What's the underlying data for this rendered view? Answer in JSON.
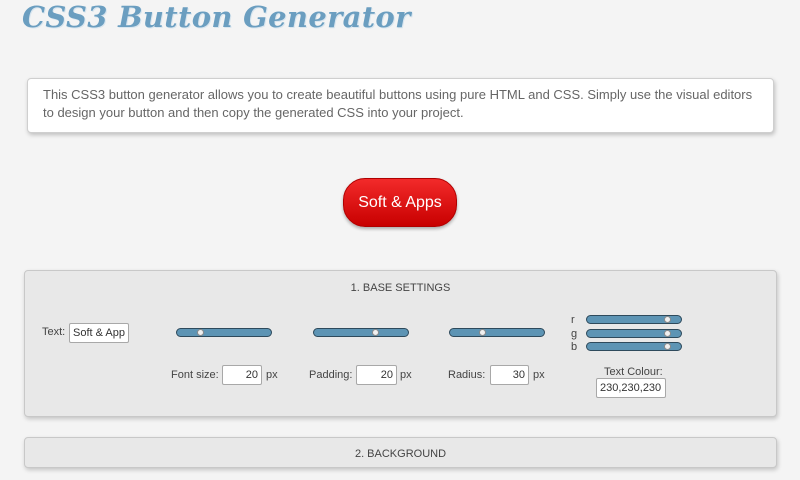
{
  "header": {
    "title": "CSS3 Button Generator"
  },
  "intro": {
    "text": "This CSS3 button generator allows you to create beautiful buttons using pure HTML and CSS. Simply use the visual editors to design your button and then copy the generated CSS into your project."
  },
  "preview": {
    "button_label": "Soft & Apps",
    "color": "#e01414"
  },
  "base_settings": {
    "title": "1. BASE SETTINGS",
    "text_label": "Text:",
    "text_value": "Soft & Apps",
    "font_size": {
      "label": "Font size:",
      "value": "20",
      "unit": "px",
      "slider_level": 0.25
    },
    "padding": {
      "label": "Padding:",
      "value": "20",
      "unit": "px",
      "slider_level": 0.65
    },
    "radius": {
      "label": "Radius:",
      "value": "30",
      "unit": "px",
      "slider_level": 0.35
    },
    "text_colour": {
      "label": "Text Colour:",
      "value": "230,230,230",
      "r_label": "r",
      "g_label": "g",
      "b_label": "b",
      "r_level": 0.86,
      "g_level": 0.86,
      "b_level": 0.86
    }
  },
  "background": {
    "title": "2. BACKGROUND"
  },
  "colors": {
    "title": "#6b9ec0",
    "slider": "#5d94b4",
    "button": "#e01414"
  }
}
